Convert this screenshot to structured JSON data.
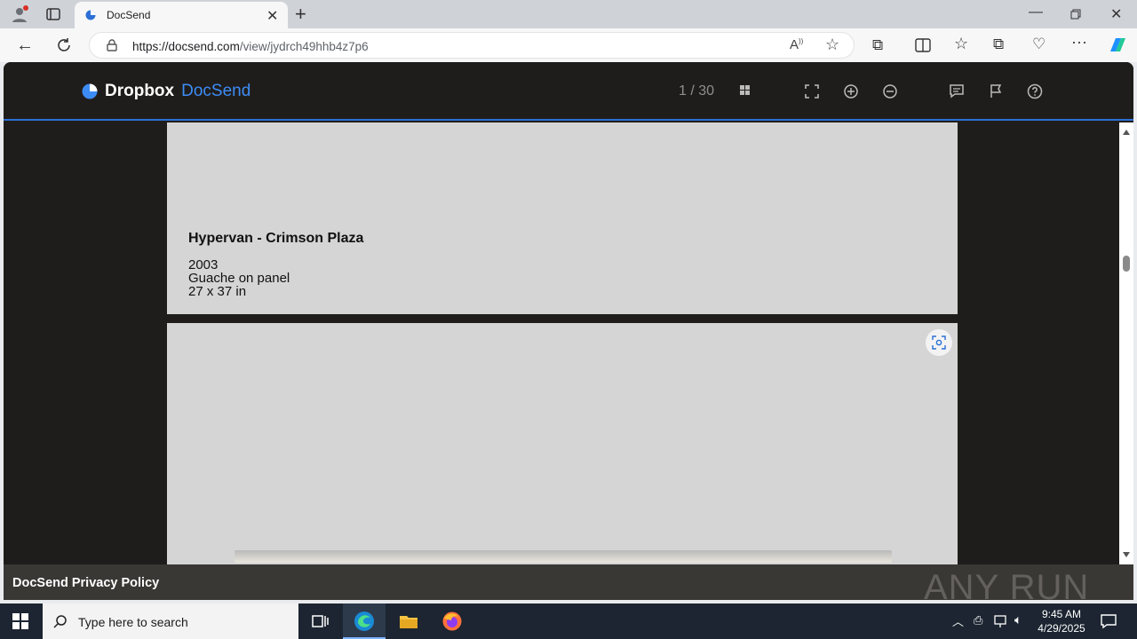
{
  "browser": {
    "tab_title": "DocSend",
    "url_host": "https://docsend.com",
    "url_path": "/view/jydrch49hhb4z7p6"
  },
  "docsend": {
    "brand_primary": "Dropbox",
    "brand_secondary": "DocSend",
    "page_counter": "1 / 30",
    "accent_color": "#2b6fd6"
  },
  "slide1": {
    "title": "Hypervan - Crimson Plaza",
    "year": "2003",
    "medium": "Guache on panel",
    "dimensions": "27 x 37 in"
  },
  "footer": {
    "privacy_link": "DocSend Privacy Policy",
    "watermark": "ANY RUN"
  },
  "taskbar": {
    "search_placeholder": "Type here to search",
    "time": "9:45 AM",
    "date": "4/29/2025"
  }
}
